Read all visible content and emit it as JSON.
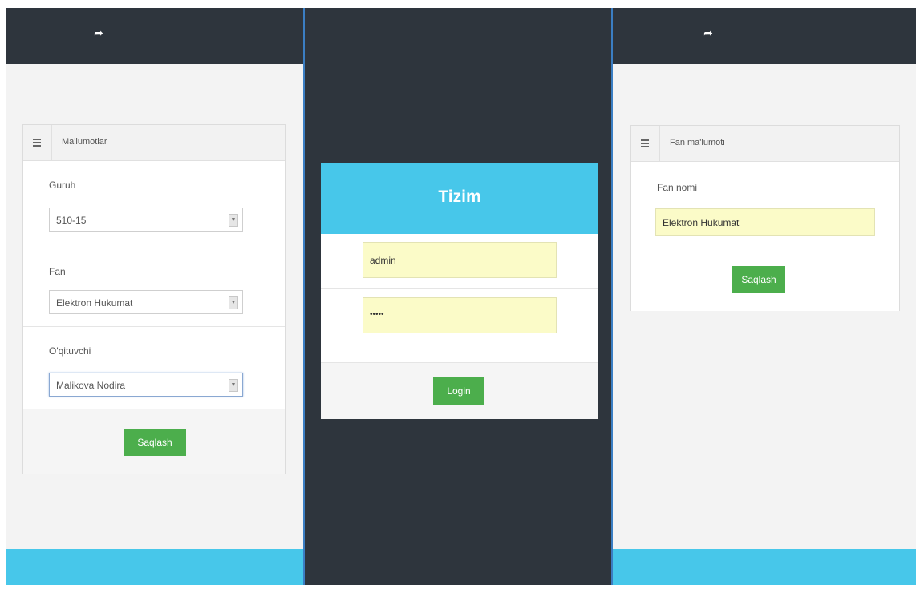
{
  "left": {
    "card_title": "Ma'lumotlar",
    "fields": [
      {
        "label": "Guruh",
        "value": "510-15"
      },
      {
        "label": "Fan",
        "value": "Elektron Hukumat"
      },
      {
        "label": "O'qituvchi",
        "value": "Malikova Nodira"
      }
    ],
    "save_label": "Saqlash"
  },
  "login": {
    "title": "Tizim",
    "username": "admin",
    "password": "•••••",
    "login_label": "Login"
  },
  "right": {
    "card_title": "Fan ma'lumoti",
    "field_label": "Fan nomi",
    "field_value": "Elektron Hukumat",
    "save_label": "Saqlash"
  },
  "colors": {
    "dark": "#2e353d",
    "accent": "#47c7ea",
    "button": "#4cae4c",
    "input_autofill": "#fbfbc8"
  },
  "icons": [
    "share-icon",
    "menu-icon",
    "chevron-down-icon"
  ]
}
